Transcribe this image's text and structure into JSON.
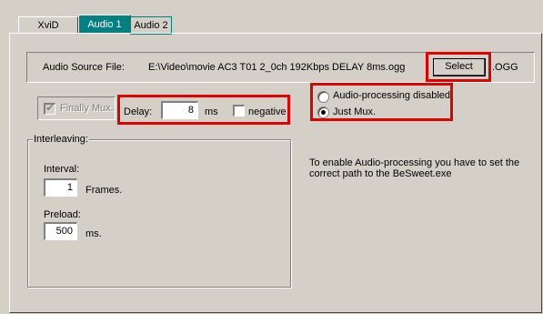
{
  "tabs": [
    {
      "label": "XviD",
      "active": false
    },
    {
      "label": "Audio 1",
      "active": true
    },
    {
      "label": "Audio 2",
      "active": false
    }
  ],
  "source": {
    "label": "Audio Source File:",
    "path": "E:\\Video\\movie AC3 T01 2_0ch 192Kbps DELAY 8ms.ogg",
    "select_label": "Select",
    "ext_label": ".OGG"
  },
  "mux": {
    "finally_mux_label": "Finally Mux.",
    "finally_mux_checked": true,
    "delay_label": "Delay:",
    "delay_value": "8",
    "delay_unit": "ms",
    "negative_label": "negative",
    "negative_checked": false
  },
  "processing": {
    "disabled_label": "Audio-processing disabled.",
    "just_mux_label": "Just Mux.",
    "selected": "just_mux"
  },
  "interleaving": {
    "title": "Interleaving:",
    "interval_label": "Interval:",
    "interval_value": "1",
    "interval_unit": "Frames.",
    "preload_label": "Preload:",
    "preload_value": "500",
    "preload_unit": "ms."
  },
  "info_text": "To enable Audio-processing you have to set the correct path to the BeSweet.exe",
  "colors": {
    "highlight": "#e00000",
    "active_tab": "#008080",
    "window_bg": "#d4d0c8"
  }
}
